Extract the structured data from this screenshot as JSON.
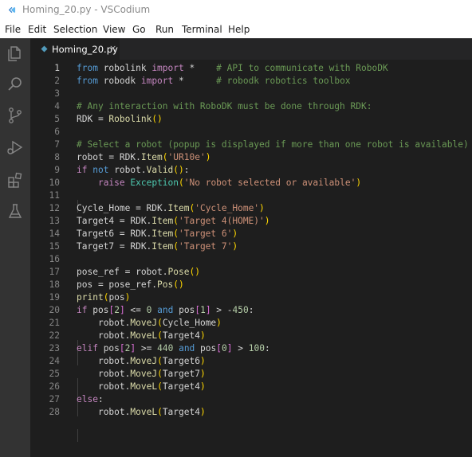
{
  "window": {
    "title": "Homing_20.py - VSCodium",
    "app_icon": "vscodium-logo-icon"
  },
  "menu": [
    "File",
    "Edit",
    "Selection",
    "View",
    "Go",
    "Run",
    "Terminal",
    "Help"
  ],
  "activity_bar": [
    {
      "name": "explorer-icon"
    },
    {
      "name": "search-icon"
    },
    {
      "name": "source-control-icon"
    },
    {
      "name": "run-debug-icon"
    },
    {
      "name": "extensions-icon"
    },
    {
      "name": "testing-icon"
    }
  ],
  "tab": {
    "label": "Homing_20.py",
    "close": "×",
    "icon": "python-file-icon"
  },
  "colors": {
    "keyword": "#569cd6",
    "control": "#c586c0",
    "string": "#ce9178",
    "comment": "#6a9955",
    "number": "#b5cea8",
    "function": "#dcdcaa",
    "class": "#4ec9b0",
    "text": "#d4d4d4"
  },
  "code": [
    {
      "n": "1",
      "tokens": [
        [
          "kw",
          "from"
        ],
        [
          "var",
          " robolink "
        ],
        [
          "ctl",
          "import"
        ],
        [
          "op",
          " *    "
        ],
        [
          "com",
          "# API to communicate with RoboDK"
        ]
      ]
    },
    {
      "n": "2",
      "tokens": [
        [
          "kw",
          "from"
        ],
        [
          "var",
          " robodk "
        ],
        [
          "ctl",
          "import"
        ],
        [
          "op",
          " *      "
        ],
        [
          "com",
          "# robodk robotics toolbox"
        ]
      ]
    },
    {
      "n": "3",
      "tokens": []
    },
    {
      "n": "4",
      "tokens": [
        [
          "com",
          "# Any interaction with RoboDK must be done through RDK:"
        ]
      ]
    },
    {
      "n": "5",
      "tokens": [
        [
          "var",
          "RDK = "
        ],
        [
          "fn",
          "Robolink"
        ],
        [
          "br",
          "()"
        ]
      ]
    },
    {
      "n": "6",
      "tokens": []
    },
    {
      "n": "7",
      "tokens": [
        [
          "com",
          "# Select a robot (popup is displayed if more than one robot is available)"
        ]
      ]
    },
    {
      "n": "8",
      "tokens": [
        [
          "var",
          "robot = RDK."
        ],
        [
          "fn",
          "Item"
        ],
        [
          "br",
          "("
        ],
        [
          "str",
          "'UR10e'"
        ],
        [
          "br",
          ")"
        ]
      ]
    },
    {
      "n": "9",
      "tokens": [
        [
          "ctl",
          "if"
        ],
        [
          "op",
          " "
        ],
        [
          "kw",
          "not"
        ],
        [
          "var",
          " robot."
        ],
        [
          "fn",
          "Valid"
        ],
        [
          "br",
          "()"
        ],
        [
          "op",
          ":"
        ]
      ]
    },
    {
      "n": "10",
      "tokens": [
        [
          "op",
          "    "
        ],
        [
          "ctl",
          "raise"
        ],
        [
          "op",
          " "
        ],
        [
          "cls",
          "Exception"
        ],
        [
          "br",
          "("
        ],
        [
          "str",
          "'No robot selected or available'"
        ],
        [
          "br",
          ")"
        ]
      ]
    },
    {
      "n": "11",
      "tokens": []
    },
    {
      "n": "12",
      "tokens": [
        [
          "var",
          "Cycle_Home = RDK."
        ],
        [
          "fn",
          "Item"
        ],
        [
          "br",
          "("
        ],
        [
          "str",
          "'Cycle_Home'"
        ],
        [
          "br",
          ")"
        ]
      ]
    },
    {
      "n": "13",
      "tokens": [
        [
          "var",
          "Target4 = RDK."
        ],
        [
          "fn",
          "Item"
        ],
        [
          "br",
          "("
        ],
        [
          "str",
          "'Target 4(HOME)'"
        ],
        [
          "br",
          ")"
        ]
      ]
    },
    {
      "n": "14",
      "tokens": [
        [
          "var",
          "Target6 = RDK."
        ],
        [
          "fn",
          "Item"
        ],
        [
          "br",
          "("
        ],
        [
          "str",
          "'Target 6'"
        ],
        [
          "br",
          ")"
        ]
      ]
    },
    {
      "n": "15",
      "tokens": [
        [
          "var",
          "Target7 = RDK."
        ],
        [
          "fn",
          "Item"
        ],
        [
          "br",
          "("
        ],
        [
          "str",
          "'Target 7'"
        ],
        [
          "br",
          ")"
        ]
      ]
    },
    {
      "n": "16",
      "tokens": []
    },
    {
      "n": "17",
      "tokens": [
        [
          "var",
          "pose_ref = robot."
        ],
        [
          "fn",
          "Pose"
        ],
        [
          "br",
          "()"
        ]
      ]
    },
    {
      "n": "18",
      "tokens": [
        [
          "var",
          "pos = pose_ref."
        ],
        [
          "fn",
          "Pos"
        ],
        [
          "br",
          "()"
        ]
      ]
    },
    {
      "n": "19",
      "tokens": [
        [
          "fn",
          "print"
        ],
        [
          "br",
          "("
        ],
        [
          "var",
          "pos"
        ],
        [
          "br",
          ")"
        ]
      ]
    },
    {
      "n": "20",
      "tokens": [
        [
          "ctl",
          "if"
        ],
        [
          "var",
          " pos"
        ],
        [
          "br2",
          "["
        ],
        [
          "num",
          "2"
        ],
        [
          "br2",
          "]"
        ],
        [
          "op",
          " <= "
        ],
        [
          "num",
          "0"
        ],
        [
          "op",
          " "
        ],
        [
          "kw",
          "and"
        ],
        [
          "var",
          " pos"
        ],
        [
          "br2",
          "["
        ],
        [
          "num",
          "1"
        ],
        [
          "br2",
          "]"
        ],
        [
          "op",
          " > -"
        ],
        [
          "num",
          "450"
        ],
        [
          "op",
          ":"
        ]
      ]
    },
    {
      "n": "21",
      "tokens": [
        [
          "op",
          "    "
        ],
        [
          "var",
          "robot."
        ],
        [
          "fn",
          "MoveJ"
        ],
        [
          "br",
          "("
        ],
        [
          "var",
          "Cycle_Home"
        ],
        [
          "br",
          ")"
        ]
      ]
    },
    {
      "n": "22",
      "tokens": [
        [
          "op",
          "    "
        ],
        [
          "var",
          "robot."
        ],
        [
          "fn",
          "MoveL"
        ],
        [
          "br",
          "("
        ],
        [
          "var",
          "Target4"
        ],
        [
          "br",
          ")"
        ]
      ]
    },
    {
      "n": "23",
      "tokens": [
        [
          "ctl",
          "elif"
        ],
        [
          "var",
          " pos"
        ],
        [
          "br2",
          "["
        ],
        [
          "num",
          "2"
        ],
        [
          "br2",
          "]"
        ],
        [
          "op",
          " >= "
        ],
        [
          "num",
          "440"
        ],
        [
          "op",
          " "
        ],
        [
          "kw",
          "and"
        ],
        [
          "var",
          " pos"
        ],
        [
          "br2",
          "["
        ],
        [
          "num",
          "0"
        ],
        [
          "br2",
          "]"
        ],
        [
          "op",
          " > "
        ],
        [
          "num",
          "100"
        ],
        [
          "op",
          ":"
        ]
      ]
    },
    {
      "n": "24",
      "tokens": [
        [
          "op",
          "    "
        ],
        [
          "var",
          "robot."
        ],
        [
          "fn",
          "MoveJ"
        ],
        [
          "br",
          "("
        ],
        [
          "var",
          "Target6"
        ],
        [
          "br",
          ")"
        ]
      ]
    },
    {
      "n": "25",
      "tokens": [
        [
          "op",
          "    "
        ],
        [
          "var",
          "robot."
        ],
        [
          "fn",
          "MoveJ"
        ],
        [
          "br",
          "("
        ],
        [
          "var",
          "Target7"
        ],
        [
          "br",
          ")"
        ]
      ]
    },
    {
      "n": "26",
      "tokens": [
        [
          "op",
          "    "
        ],
        [
          "var",
          "robot."
        ],
        [
          "fn",
          "MoveL"
        ],
        [
          "br",
          "("
        ],
        [
          "var",
          "Target4"
        ],
        [
          "br",
          ")"
        ]
      ]
    },
    {
      "n": "27",
      "tokens": [
        [
          "ctl",
          "else"
        ],
        [
          "op",
          ":"
        ]
      ]
    },
    {
      "n": "28",
      "tokens": [
        [
          "op",
          "    "
        ],
        [
          "var",
          "robot."
        ],
        [
          "fn",
          "MoveL"
        ],
        [
          "br",
          "("
        ],
        [
          "var",
          "Target4"
        ],
        [
          "br",
          ")"
        ]
      ]
    }
  ]
}
